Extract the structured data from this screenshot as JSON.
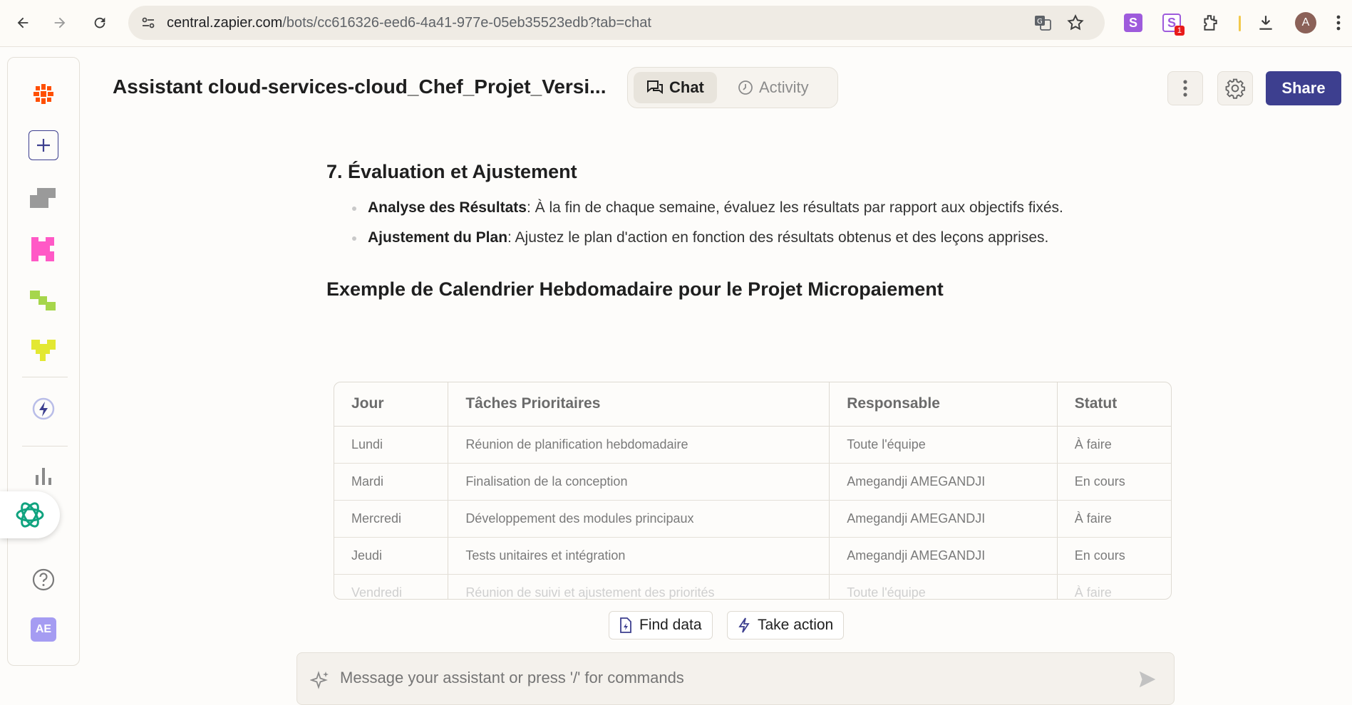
{
  "browser": {
    "url_host": "central.zapier.com",
    "url_path": "/bots/cc616326-eed6-4a41-977e-05eb35523edb?tab=chat",
    "extension_badge": "1",
    "profile_initial": "A"
  },
  "header": {
    "title": "Assistant cloud-services-cloud_Chef_Projet_Versi...",
    "tabs": [
      {
        "label": "Chat",
        "active": true
      },
      {
        "label": "Activity",
        "active": false
      }
    ],
    "share_label": "Share"
  },
  "sidebar": {
    "user_initials": "AE",
    "colors": {
      "zapier": "#ff4f00",
      "pink": "#ff59c6",
      "green": "#a6d64b",
      "yellow": "#e3e832",
      "gray": "#9a9a9a"
    }
  },
  "content": {
    "section_title": "7. Évaluation et Ajustement",
    "bullets": [
      {
        "term": "Analyse des Résultats",
        "text": ": À la fin de chaque semaine, évaluez les résultats par rapport aux objectifs fixés."
      },
      {
        "term": "Ajustement du Plan",
        "text": ": Ajustez le plan d'action en fonction des résultats obtenus et des leçons apprises."
      }
    ],
    "example_title": "Exemple de Calendrier Hebdomadaire pour le Projet Micropaiement",
    "table": {
      "headers": [
        "Jour",
        "Tâches Prioritaires",
        "Responsable",
        "Statut"
      ],
      "rows": [
        [
          "Lundi",
          "Réunion de planification hebdomadaire",
          "Toute l'équipe",
          "À faire"
        ],
        [
          "Mardi",
          "Finalisation de la conception",
          "Amegandji AMEGANDJI",
          "En cours"
        ],
        [
          "Mercredi",
          "Développement des modules principaux",
          "Amegandji AMEGANDJI",
          "À faire"
        ],
        [
          "Jeudi",
          "Tests unitaires et intégration",
          "Amegandji AMEGANDJI",
          "En cours"
        ],
        [
          "Vendredi",
          "Réunion de suivi et ajustement des priorités",
          "Toute l'équipe",
          "À faire"
        ]
      ]
    }
  },
  "actions": {
    "find_data": "Find data",
    "take_action": "Take action"
  },
  "composer": {
    "placeholder": "Message your assistant or press '/' for commands"
  }
}
